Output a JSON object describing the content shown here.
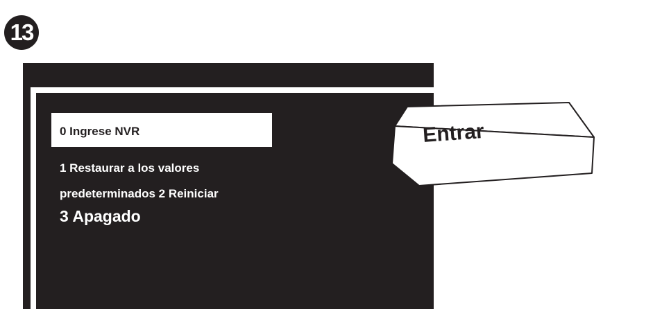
{
  "step": {
    "number": "13"
  },
  "screen": {
    "menu_items": [
      "0 Ingrese NVR",
      "1 Restaurar a los valores",
      "predeterminados 2 Reiniciar",
      "3 Apagado"
    ],
    "selected_index": 0
  },
  "key": {
    "label": "Entrar",
    "icon": "enter-key-icon"
  }
}
